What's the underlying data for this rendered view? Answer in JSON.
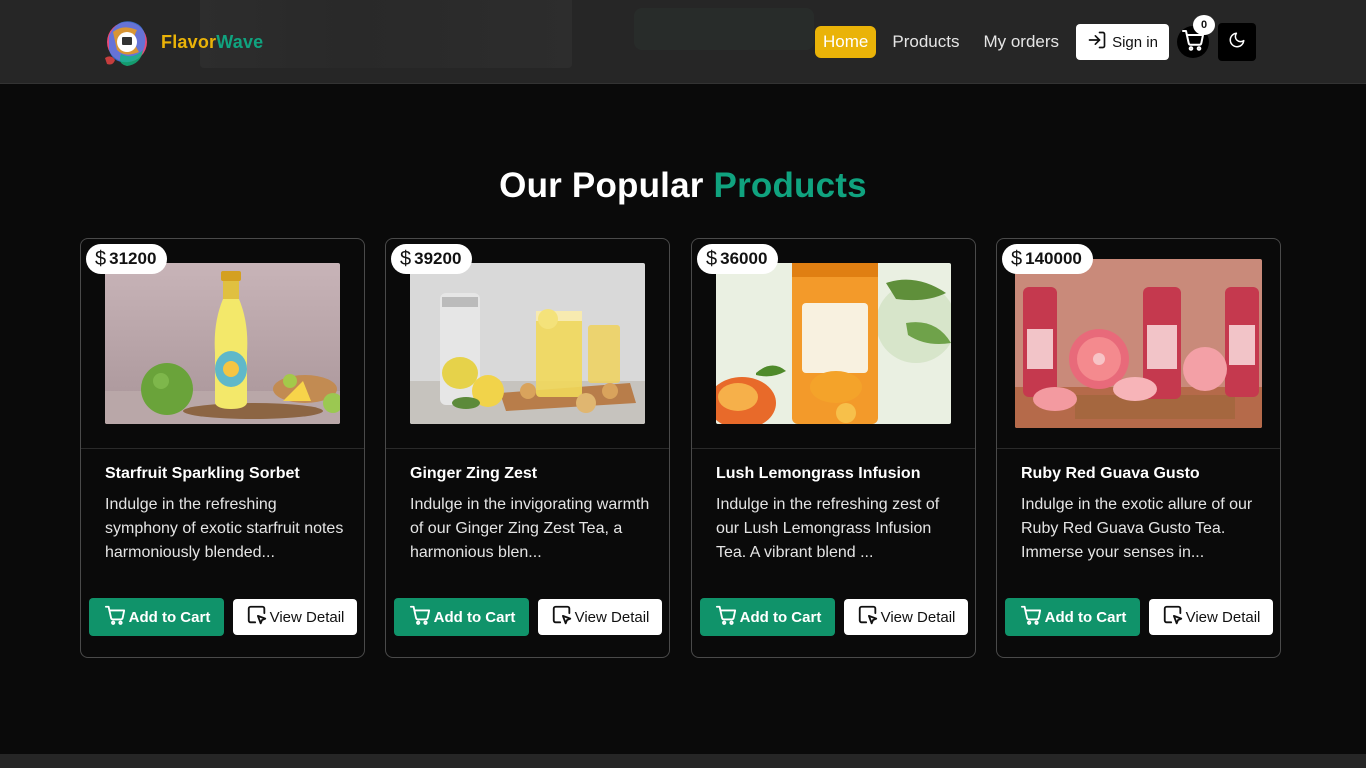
{
  "brand": {
    "part1": "Flavor",
    "part2": "Wave",
    "icon": "flavorwave-logo-icon"
  },
  "nav": {
    "links": [
      {
        "label": "Home",
        "active": true
      },
      {
        "label": "Products",
        "active": false
      },
      {
        "label": "My orders",
        "active": false
      }
    ],
    "signin_label": "Sign in",
    "signin_icon": "sign-in-icon",
    "cart_count": "0",
    "cart_icon": "cart-icon",
    "theme_icon": "moon-icon"
  },
  "section": {
    "title_part1": "Our Popular ",
    "title_part2": "Products"
  },
  "products": [
    {
      "price": "31200",
      "name": "Starfruit Sparkling Sorbet",
      "description": "Indulge in the refreshing symphony of exotic starfruit notes harmoniously blended...",
      "add_label": "Add to Cart",
      "detail_label": "View Detail"
    },
    {
      "price": "39200",
      "name": "Ginger Zing Zest",
      "description": "Indulge in the invigorating warmth of our Ginger Zing Zest Tea, a harmonious blen...",
      "add_label": "Add to Cart",
      "detail_label": "View Detail"
    },
    {
      "price": "36000",
      "name": "Lush Lemongrass Infusion",
      "description": "Indulge in the refreshing zest of our Lush Lemongrass Infusion Tea. A vibrant blend ...",
      "add_label": "Add to Cart",
      "detail_label": "View Detail"
    },
    {
      "price": "140000",
      "name": "Ruby Red Guava Gusto",
      "description": "Indulge in the exotic allure of our Ruby Red Guava Gusto Tea. Immerse your senses in...",
      "add_label": "Add to Cart",
      "detail_label": "View Detail"
    }
  ],
  "colors": {
    "accent_green": "#10a37f",
    "brand_yellow": "#eab308",
    "button_green": "#10936a",
    "background": "#0a0a0a"
  },
  "currency_symbol": "$"
}
